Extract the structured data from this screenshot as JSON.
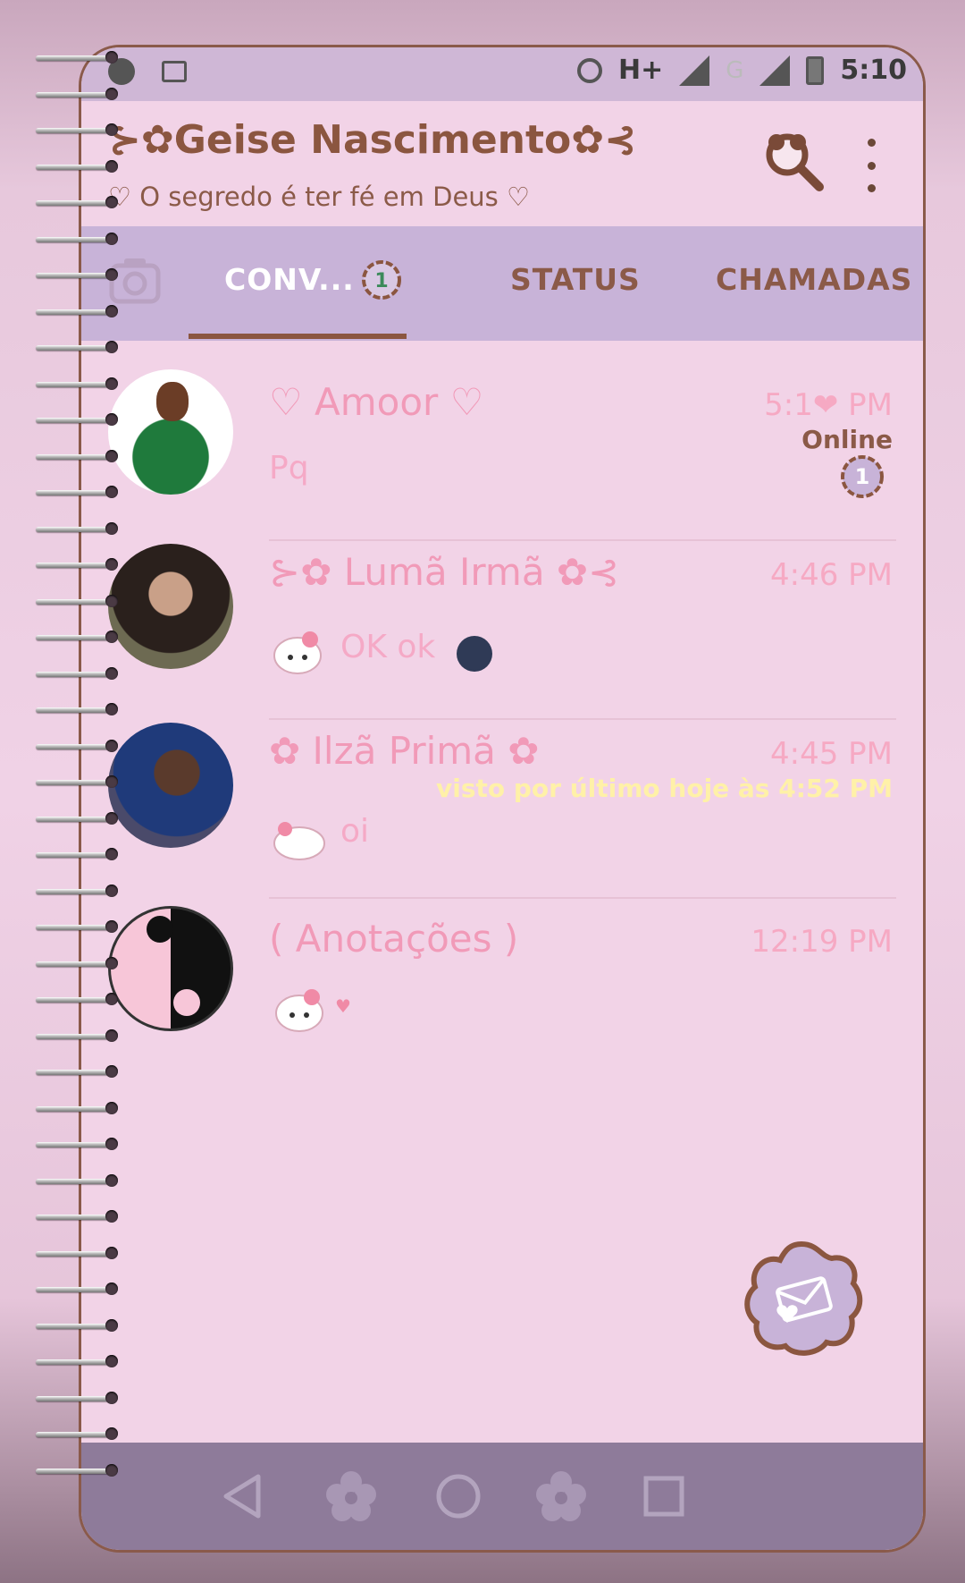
{
  "status_bar": {
    "network": "H+",
    "network2": "G",
    "time": "5:10"
  },
  "header": {
    "title": "⊱✿Geise Nascimento✿⊰",
    "subtitle": "♡ O segredo é ter fé em Deus ♡"
  },
  "tabs": {
    "conversations": "CONV...",
    "conversations_badge": "1",
    "status": "STATUS",
    "calls": "CHAMADAS"
  },
  "chats": [
    {
      "name": "♡ Amoor ♡",
      "time": "5:1❤ PM",
      "message": "Pq",
      "presence": "Online",
      "unread": "1"
    },
    {
      "name": "⊱✿ Lumã Irmã ✿⊰",
      "time": "4:46 PM",
      "message": "OK ok"
    },
    {
      "name": "✿ Ilzã Primã ✿",
      "time": "4:45 PM",
      "last_seen": "visto por último hoje às 4:52 PM",
      "message": "oi"
    },
    {
      "name": "( Anotações )",
      "time": "12:19 PM",
      "message": "♥"
    }
  ],
  "colors": {
    "accent": "#8b5640",
    "tab_bar": "#c8b3d8",
    "chat_text": "#f19ab8",
    "background": "#f2d3e7"
  },
  "icons": [
    "search-icon",
    "more-vert-icon",
    "camera-icon",
    "new-chat-icon",
    "back-icon",
    "home-icon",
    "recents-icon"
  ]
}
